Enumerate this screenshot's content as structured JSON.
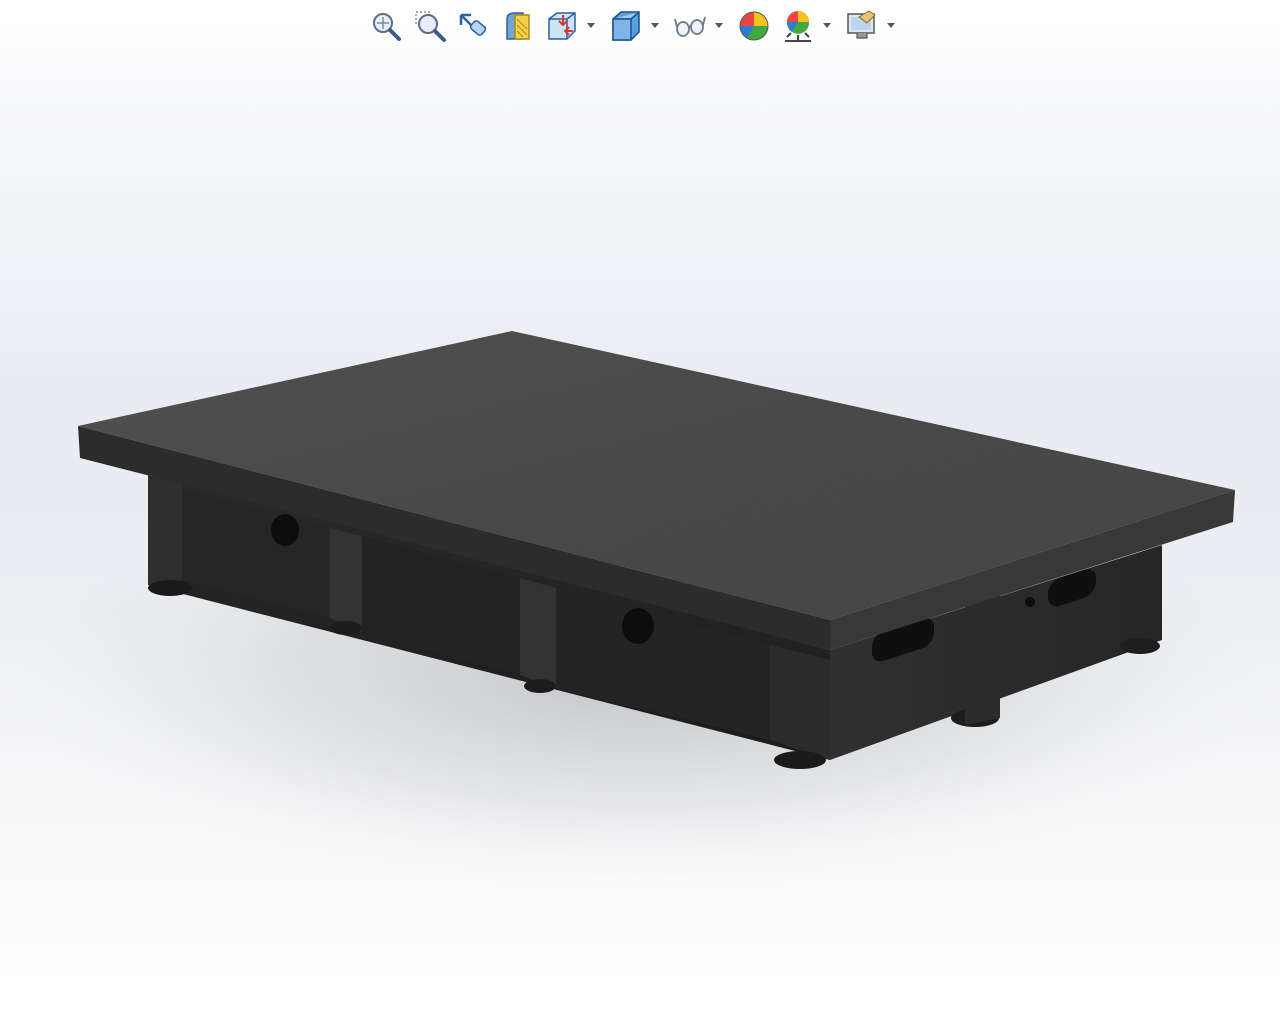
{
  "app": {
    "viewport_name": "graphics-area"
  },
  "toolbar": {
    "buttons": [
      {
        "name": "zoom-to-fit",
        "icon": "zoom-to-fit-icon"
      },
      {
        "name": "zoom-to-area",
        "icon": "zoom-to-area-icon"
      },
      {
        "name": "previous-view",
        "icon": "previous-view-icon"
      },
      {
        "name": "section-view",
        "icon": "section-view-icon"
      },
      {
        "name": "view-orientation",
        "icon": "view-orientation-icon",
        "has_dropdown": true
      },
      {
        "name": "display-style",
        "icon": "display-style-icon",
        "has_dropdown": true
      },
      {
        "name": "hide-show-items",
        "icon": "hide-show-glasses-icon",
        "has_dropdown": true
      },
      {
        "name": "edit-appearance",
        "icon": "edit-appearance-icon"
      },
      {
        "name": "apply-scene",
        "icon": "apply-scene-icon",
        "has_dropdown": true
      },
      {
        "name": "view-settings",
        "icon": "view-settings-monitor-icon",
        "has_dropdown": true
      }
    ]
  },
  "model": {
    "description": "surface-plate",
    "colors": {
      "top_surface": "#4a4a4a",
      "side_dark": "#222222",
      "edge": "#2e2e2e",
      "shadow": "#bfc2c6"
    }
  }
}
